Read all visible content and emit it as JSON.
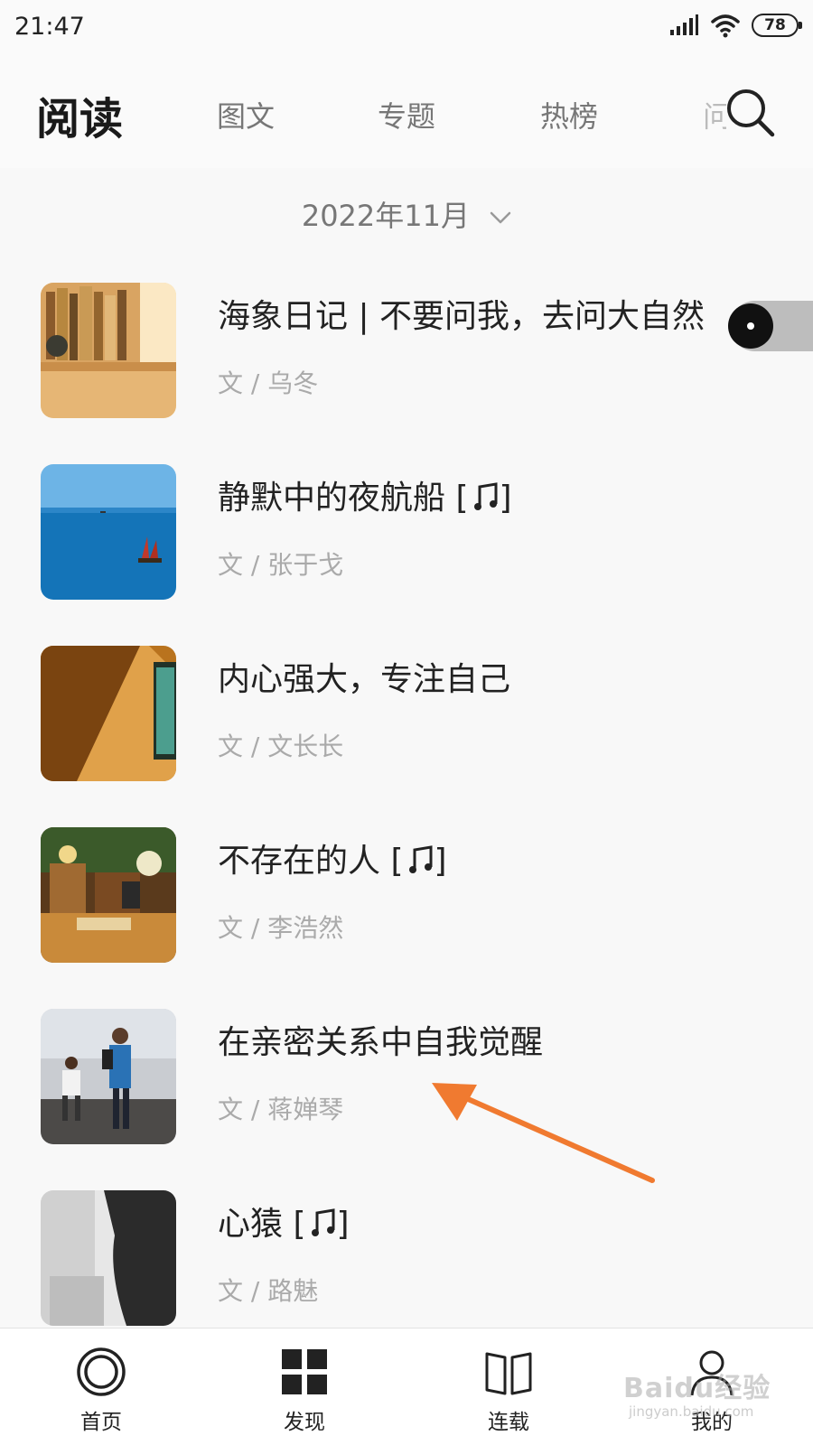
{
  "status_bar": {
    "time": "21:47",
    "battery": "78"
  },
  "header": {
    "title": "阅读",
    "tabs": [
      "图文",
      "专题",
      "热榜",
      "问"
    ]
  },
  "month_selector": {
    "label": "2022年11月"
  },
  "articles": [
    {
      "title": "海象日记 | 不要问我，去问大自然",
      "author": "文 / 乌冬",
      "music": false
    },
    {
      "title": "静默中的夜航船 [",
      "title_suffix": "]",
      "author": "文 / 张于戈",
      "music": true
    },
    {
      "title": "内心强大，专注自己",
      "author": "文 / 文长长",
      "music": false
    },
    {
      "title": "不存在的人 [",
      "title_suffix": "]",
      "author": "文 / 李浩然",
      "music": true
    },
    {
      "title": "在亲密关系中自我觉醒",
      "author": "文 / 蒋婵琴",
      "music": false
    },
    {
      "title": "心猿 [",
      "title_suffix": "]",
      "author": "文 / 路魅",
      "music": true
    }
  ],
  "bottom_nav": [
    {
      "label": "首页",
      "icon": "home-ring-icon"
    },
    {
      "label": "发现",
      "icon": "grid-icon"
    },
    {
      "label": "连载",
      "icon": "book-icon"
    },
    {
      "label": "我的",
      "icon": "user-icon"
    }
  ],
  "watermark": {
    "text": "Baidu经验",
    "sub": "jingyan.baidu.com"
  },
  "colors": {
    "accent_arrow": "#f07a30",
    "background": "#f8f8f8"
  }
}
